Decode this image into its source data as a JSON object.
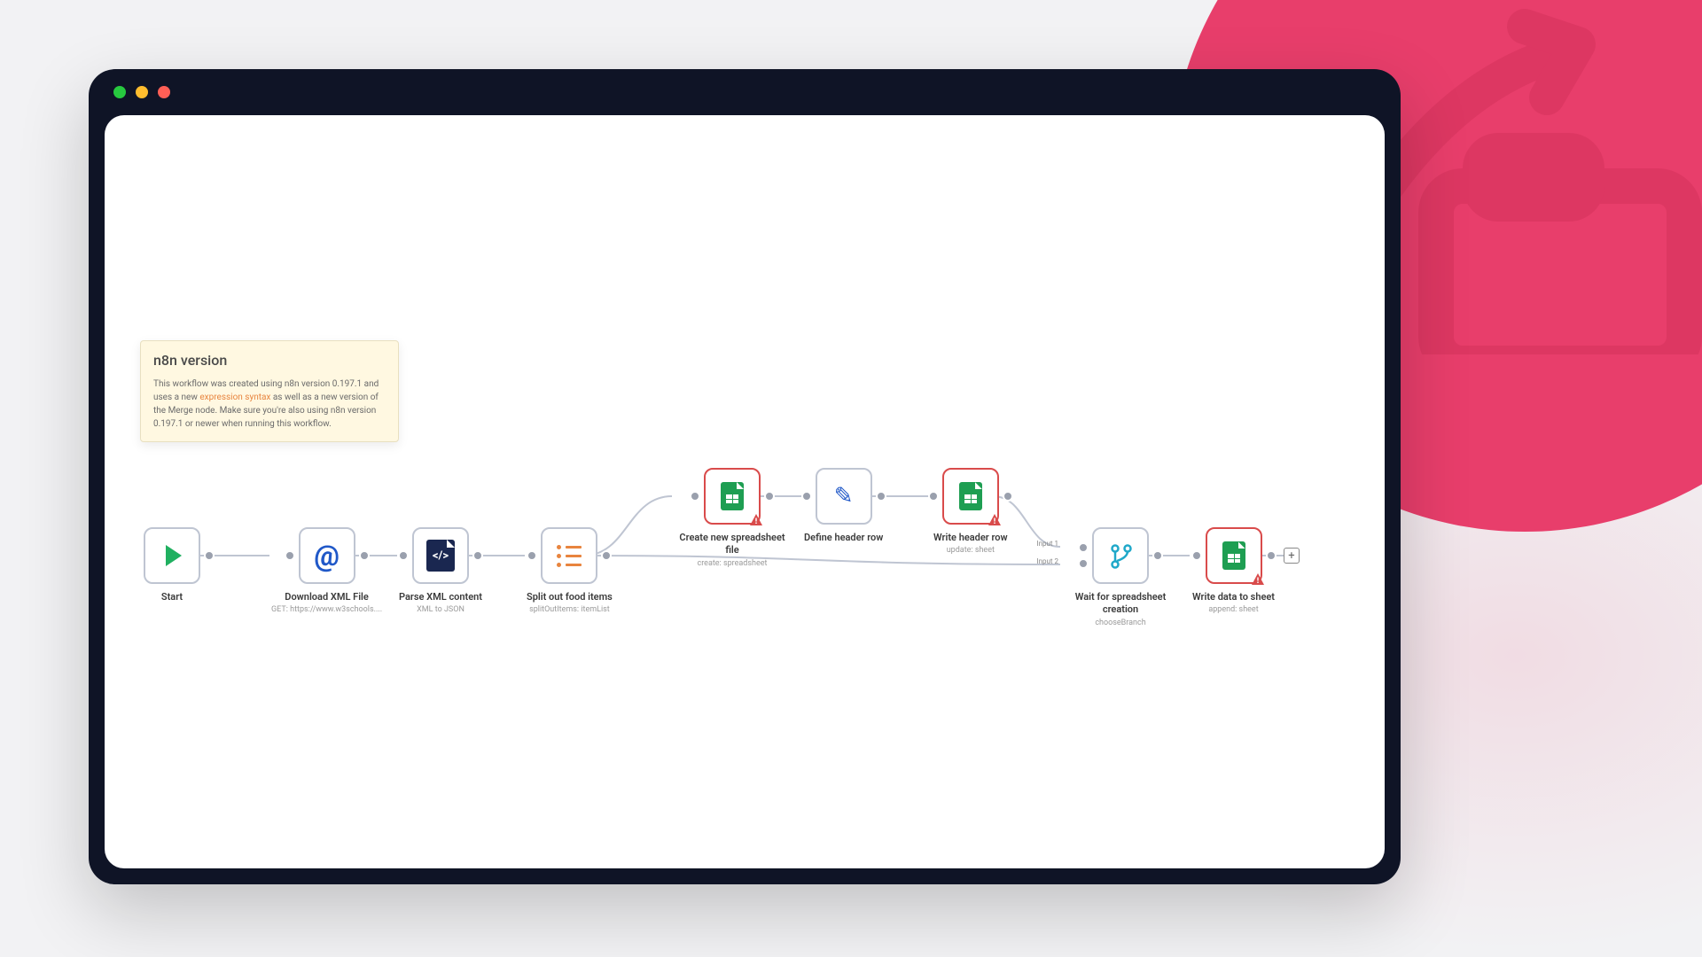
{
  "note": {
    "title": "n8n version",
    "body_pre": "This workflow was created using n8n version 0.197.1 and uses a new ",
    "body_link": "expression syntax",
    "body_post": " as well as a new version of the Merge node. Make sure you're also using n8n version 0.197.1 or newer when running this workflow."
  },
  "nodes": {
    "start": {
      "label": "Start",
      "sub": ""
    },
    "download": {
      "label": "Download XML File",
      "sub": "GET: https://www.w3schools...."
    },
    "parse": {
      "label": "Parse XML content",
      "sub": "XML to JSON"
    },
    "split": {
      "label": "Split out food items",
      "sub": "splitOutItems: itemList"
    },
    "create": {
      "label": "Create new spreadsheet file",
      "sub": "create: spreadsheet"
    },
    "define": {
      "label": "Define header row",
      "sub": ""
    },
    "writeheader": {
      "label": "Write header row",
      "sub": "update: sheet"
    },
    "wait": {
      "label": "Wait for spreadsheet creation",
      "sub": "chooseBranch",
      "input1": "Input 1",
      "input2": "Input 2"
    },
    "writedata": {
      "label": "Write data to sheet",
      "sub": "append: sheet"
    }
  },
  "add_button": "+"
}
